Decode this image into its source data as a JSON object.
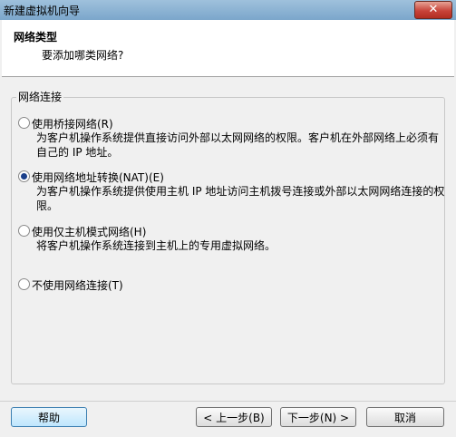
{
  "window": {
    "title": "新建虚拟机向导",
    "close_label": "✕"
  },
  "header": {
    "title": "网络类型",
    "subtitle": "要添加哪类网络?"
  },
  "group": {
    "legend": "网络连接"
  },
  "options": [
    {
      "label": "使用桥接网络(R)",
      "desc": "为客户机操作系统提供直接访问外部以太网网络的权限。客户机在外部网络上必须有自己的 IP 地址。",
      "checked": false
    },
    {
      "label": "使用网络地址转换(NAT)(E)",
      "desc": "为客户机操作系统提供使用主机 IP 地址访问主机拨号连接或外部以太网网络连接的权限。",
      "checked": true
    },
    {
      "label": "使用仅主机模式网络(H)",
      "desc": "将客户机操作系统连接到主机上的专用虚拟网络。",
      "checked": false
    },
    {
      "label": "不使用网络连接(T)",
      "desc": "",
      "checked": false
    }
  ],
  "buttons": {
    "help": "帮助",
    "back": "< 上一步(B)",
    "next": "下一步(N) >",
    "cancel": "取消"
  }
}
